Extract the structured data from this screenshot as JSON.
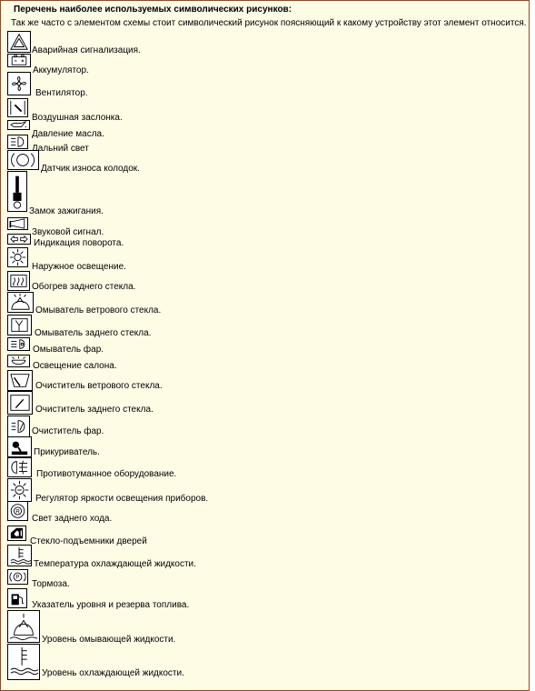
{
  "heading": "Перечень наиболее используемых символических рисунков:",
  "intro": "Так же часто с элементом схемы стоит символический рисунок поясняющий к какому устройству этот элемент относится.",
  "symbols": [
    {
      "icon": "hazard-warning-icon",
      "label": "Аварийная сигнализация."
    },
    {
      "icon": "battery-icon",
      "label": "Аккумулятор."
    },
    {
      "icon": "fan-icon",
      "label": "Вентилятор."
    },
    {
      "icon": "air-damper-icon",
      "label": "Воздушная заслонка."
    },
    {
      "icon": "oil-pressure-icon",
      "label": "Давление масла."
    },
    {
      "icon": "high-beam-icon",
      "label": "Дальний свет"
    },
    {
      "icon": "brake-pad-wear-icon",
      "label": "Датчик износа колодок."
    },
    {
      "icon": "ignition-key-icon",
      "label": "Замок зажигания."
    },
    {
      "icon": "horn-icon",
      "label": "Звуковой сигнал."
    },
    {
      "icon": "turn-signal-icon",
      "label": "Индикация поворота."
    },
    {
      "icon": "exterior-light-icon",
      "label": "Наружное освещение."
    },
    {
      "icon": "rear-defrost-icon",
      "label": "Обогрев заднего стекла."
    },
    {
      "icon": "windshield-washer-icon",
      "label": "Омыватель ветрового стекла."
    },
    {
      "icon": "rear-window-washer-icon",
      "label": "Омыватель заднего стекла."
    },
    {
      "icon": "headlamp-washer-icon",
      "label": "Омыватель фар."
    },
    {
      "icon": "interior-light-icon",
      "label": "Освещение салона."
    },
    {
      "icon": "windshield-wiper-icon",
      "label": "Очиститель ветрового стекла."
    },
    {
      "icon": "rear-wiper-icon",
      "label": "Очиститель заднего стекла."
    },
    {
      "icon": "headlamp-wiper-icon",
      "label": "Очиститель фар."
    },
    {
      "icon": "cigarette-lighter-icon",
      "label": "Прикуриватель."
    },
    {
      "icon": "fog-light-icon",
      "label": "Противотуманное оборудование."
    },
    {
      "icon": "dashboard-dimmer-icon",
      "label": "Регулятор яркости освещения приборов."
    },
    {
      "icon": "reverse-light-icon",
      "label": "Свет заднего хода."
    },
    {
      "icon": "power-window-icon",
      "label": "Стекло-подъемники дверей"
    },
    {
      "icon": "coolant-temperature-icon",
      "label": "Температура охлаждающей жидкости."
    },
    {
      "icon": "brake-icon",
      "label": "Тормоза."
    },
    {
      "icon": "fuel-gauge-icon",
      "label": "Указатель уровня и резерва топлива."
    },
    {
      "icon": "washer-fluid-level-icon",
      "label": "Уровень омывающей жидкости."
    },
    {
      "icon": "coolant-level-icon",
      "label": "Уровень охлаждающей жидкости."
    }
  ]
}
